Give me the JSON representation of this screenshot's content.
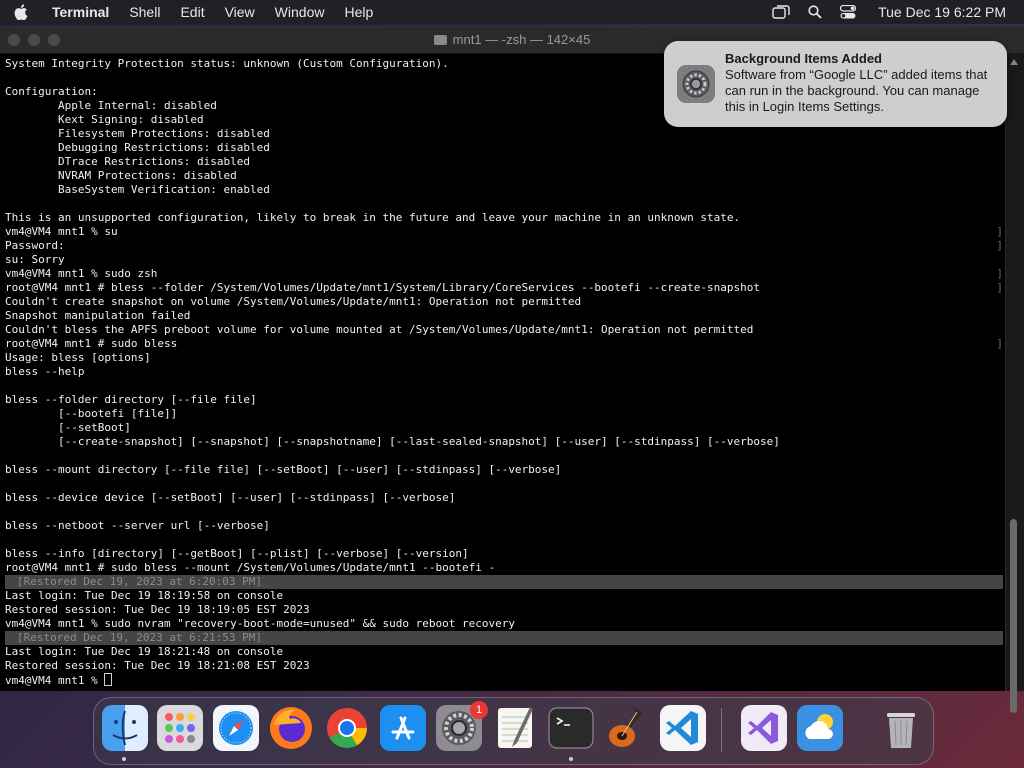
{
  "menubar": {
    "app_name": "Terminal",
    "items": [
      "Shell",
      "Edit",
      "View",
      "Window",
      "Help"
    ],
    "clock": "Tue Dec 19  6:22 PM",
    "icons": [
      "apple-icon",
      "window-mirror-icon",
      "search-icon",
      "control-center-icon"
    ]
  },
  "window": {
    "title": "mnt1 — -zsh — 142×45"
  },
  "terminal": {
    "lines": [
      {
        "text": "System Integrity Protection status: unknown (Custom Configuration).",
        "type": "normal"
      },
      {
        "text": "",
        "type": "normal"
      },
      {
        "text": "Configuration:",
        "type": "normal"
      },
      {
        "text": "        Apple Internal: disabled",
        "type": "normal"
      },
      {
        "text": "        Kext Signing: disabled",
        "type": "normal"
      },
      {
        "text": "        Filesystem Protections: disabled",
        "type": "normal"
      },
      {
        "text": "        Debugging Restrictions: disabled",
        "type": "normal"
      },
      {
        "text": "        DTrace Restrictions: disabled",
        "type": "normal"
      },
      {
        "text": "        NVRAM Protections: disabled",
        "type": "normal"
      },
      {
        "text": "        BaseSystem Verification: enabled",
        "type": "normal"
      },
      {
        "text": "",
        "type": "normal"
      },
      {
        "text": "This is an unsupported configuration, likely to break in the future and leave your machine in an unknown state.",
        "type": "normal"
      },
      {
        "text": "vm4@VM4 mnt1 % su",
        "type": "marked"
      },
      {
        "text": "Password:",
        "type": "marked"
      },
      {
        "text": "su: Sorry",
        "type": "normal"
      },
      {
        "text": "vm4@VM4 mnt1 % sudo zsh",
        "type": "marked"
      },
      {
        "text": "root@VM4 mnt1 # bless --folder /System/Volumes/Update/mnt1/System/Library/CoreServices --bootefi --create-snapshot",
        "type": "marked"
      },
      {
        "text": "Couldn't create snapshot on volume /System/Volumes/Update/mnt1: Operation not permitted",
        "type": "normal"
      },
      {
        "text": "Snapshot manipulation failed",
        "type": "normal"
      },
      {
        "text": "Couldn't bless the APFS preboot volume for volume mounted at /System/Volumes/Update/mnt1: Operation not permitted",
        "type": "normal"
      },
      {
        "text": "root@VM4 mnt1 # sudo bless",
        "type": "marked"
      },
      {
        "text": "Usage: bless [options]",
        "type": "normal"
      },
      {
        "text": "bless --help",
        "type": "normal"
      },
      {
        "text": "",
        "type": "normal"
      },
      {
        "text": "bless --folder directory [--file file]",
        "type": "normal"
      },
      {
        "text": "        [--bootefi [file]]",
        "type": "normal"
      },
      {
        "text": "        [--setBoot]",
        "type": "normal"
      },
      {
        "text": "        [--create-snapshot] [--snapshot] [--snapshotname] [--last-sealed-snapshot] [--user] [--stdinpass] [--verbose]",
        "type": "normal"
      },
      {
        "text": "",
        "type": "normal"
      },
      {
        "text": "bless --mount directory [--file file] [--setBoot] [--user] [--stdinpass] [--verbose]",
        "type": "normal"
      },
      {
        "text": "",
        "type": "normal"
      },
      {
        "text": "bless --device device [--setBoot] [--user] [--stdinpass] [--verbose]",
        "type": "normal"
      },
      {
        "text": "",
        "type": "normal"
      },
      {
        "text": "bless --netboot --server url [--verbose]",
        "type": "normal"
      },
      {
        "text": "",
        "type": "normal"
      },
      {
        "text": "bless --info [directory] [--getBoot] [--plist] [--verbose] [--version]",
        "type": "normal"
      },
      {
        "text": "root@VM4 mnt1 # sudo bless --mount /System/Volumes/Update/mnt1 --bootefi -",
        "type": "normal"
      },
      {
        "text": "[Restored Dec 19, 2023 at 6:20:03 PM]",
        "type": "restored"
      },
      {
        "text": "Last login: Tue Dec 19 18:19:58 on console",
        "type": "normal"
      },
      {
        "text": "Restored session: Tue Dec 19 18:19:05 EST 2023",
        "type": "normal"
      },
      {
        "text": "vm4@VM4 mnt1 % sudo nvram \"recovery-boot-mode=unused\" && sudo reboot recovery",
        "type": "normal"
      },
      {
        "text": "[Restored Dec 19, 2023 at 6:21:53 PM]",
        "type": "restored"
      },
      {
        "text": "Last login: Tue Dec 19 18:21:48 on console",
        "type": "normal"
      },
      {
        "text": "Restored session: Tue Dec 19 18:21:08 EST 2023",
        "type": "normal"
      }
    ],
    "prompt": "vm4@VM4 mnt1 % "
  },
  "notification": {
    "title": "Background Items Added",
    "body": "Software from “Google LLC” added items that can run in the background. You can manage this in Login Items Settings.",
    "icon": "system-settings-icon"
  },
  "dock": {
    "items": [
      {
        "name": "finder",
        "color": "#3d8fe8",
        "running": true
      },
      {
        "name": "launchpad",
        "color": "#d8d8dc",
        "running": false
      },
      {
        "name": "safari",
        "color": "#e9eef5",
        "running": false
      },
      {
        "name": "firefox",
        "color": "#5b3ad0",
        "running": false
      },
      {
        "name": "chrome",
        "color": "#e9e9e9",
        "running": false
      },
      {
        "name": "app-store",
        "color": "#1e88f0",
        "running": false
      },
      {
        "name": "system-settings",
        "color": "#8a8a8e",
        "running": false,
        "badge": "1"
      },
      {
        "name": "textedit",
        "color": "#f3f3f0",
        "running": false
      },
      {
        "name": "terminal",
        "color": "#2b2b2b",
        "running": true
      },
      {
        "name": "garageband",
        "color": "#3a2a20",
        "running": false
      },
      {
        "name": "vscode",
        "color": "#f3f3f3",
        "running": false
      },
      {
        "name": "visual-studio",
        "color": "#eee8f8",
        "running": false
      },
      {
        "name": "weather",
        "color": "#3a8ee0",
        "running": false
      },
      {
        "name": "trash",
        "color": "#c8c8cc",
        "running": false
      }
    ]
  }
}
